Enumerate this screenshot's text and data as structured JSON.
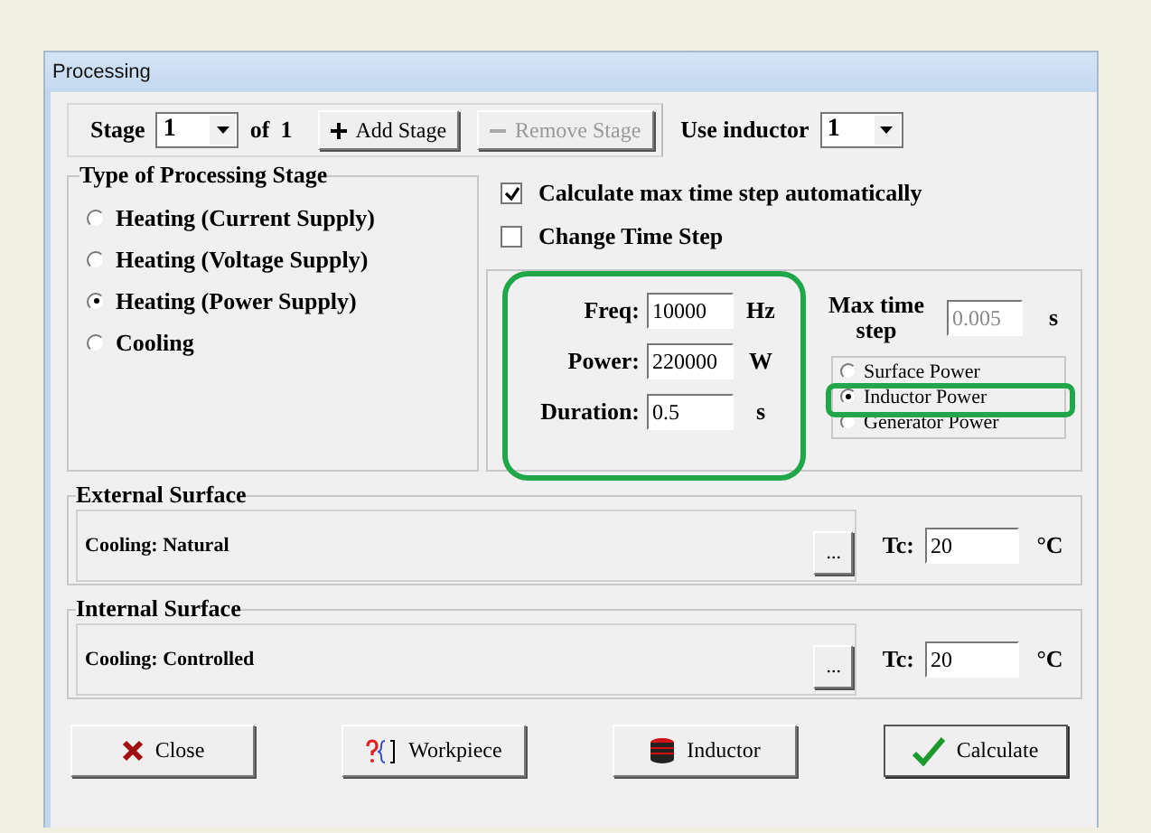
{
  "window": {
    "title": "Processing"
  },
  "stage": {
    "label": "Stage",
    "value": "1",
    "of_label": "of",
    "total": "1"
  },
  "stage_buttons": [
    {
      "kind": "add",
      "label": "Add Stage",
      "disabled": false
    },
    {
      "kind": "remove",
      "label": "Remove Stage",
      "disabled": true
    }
  ],
  "inductor": {
    "label": "Use inductor",
    "value": "1"
  },
  "stage_type": {
    "title": "Type of Processing Stage",
    "options": [
      {
        "label": "Heating (Current Supply)",
        "selected": false
      },
      {
        "label": "Heating (Voltage Supply)",
        "selected": false
      },
      {
        "label": "Heating (Power Supply)",
        "selected": true
      },
      {
        "label": "Cooling",
        "selected": false
      }
    ]
  },
  "options": [
    {
      "label": "Calculate max time step automatically",
      "checked": true
    },
    {
      "label": "Change Time Step",
      "checked": false
    }
  ],
  "parameters": {
    "highlighted": true,
    "fields": [
      {
        "label": "Freq:",
        "value": "10000",
        "unit": "Hz"
      },
      {
        "label": "Power:",
        "value": "220000",
        "unit": "W"
      },
      {
        "label": "Duration:",
        "value": "0.5",
        "unit": "s"
      }
    ]
  },
  "max_time_step": {
    "label": "Max time step",
    "value": "0.005",
    "disabled": true,
    "unit": "s"
  },
  "power_modes": [
    {
      "label": "Surface Power",
      "selected": false,
      "highlighted": false
    },
    {
      "label": "Inductor Power",
      "selected": true,
      "highlighted": true
    },
    {
      "label": "Generator Power",
      "selected": false,
      "highlighted": false
    }
  ],
  "surfaces": [
    {
      "title": "External Surface",
      "value": "Cooling: Natural",
      "button": "...",
      "tc_label": "Tc:",
      "tc_value": "20",
      "unit": "°C"
    },
    {
      "title": "Internal Surface",
      "value": "Cooling: Controlled",
      "button": "...",
      "tc_label": "Tc:",
      "tc_value": "20",
      "unit": "°C"
    }
  ],
  "buttons": [
    {
      "kind": "close",
      "label": "Close",
      "default": false
    },
    {
      "kind": "workpiece",
      "label": "Workpiece",
      "default": false
    },
    {
      "kind": "inductor",
      "label": "Inductor",
      "default": false
    },
    {
      "kind": "calculate",
      "label": "Calculate",
      "default": true
    }
  ]
}
